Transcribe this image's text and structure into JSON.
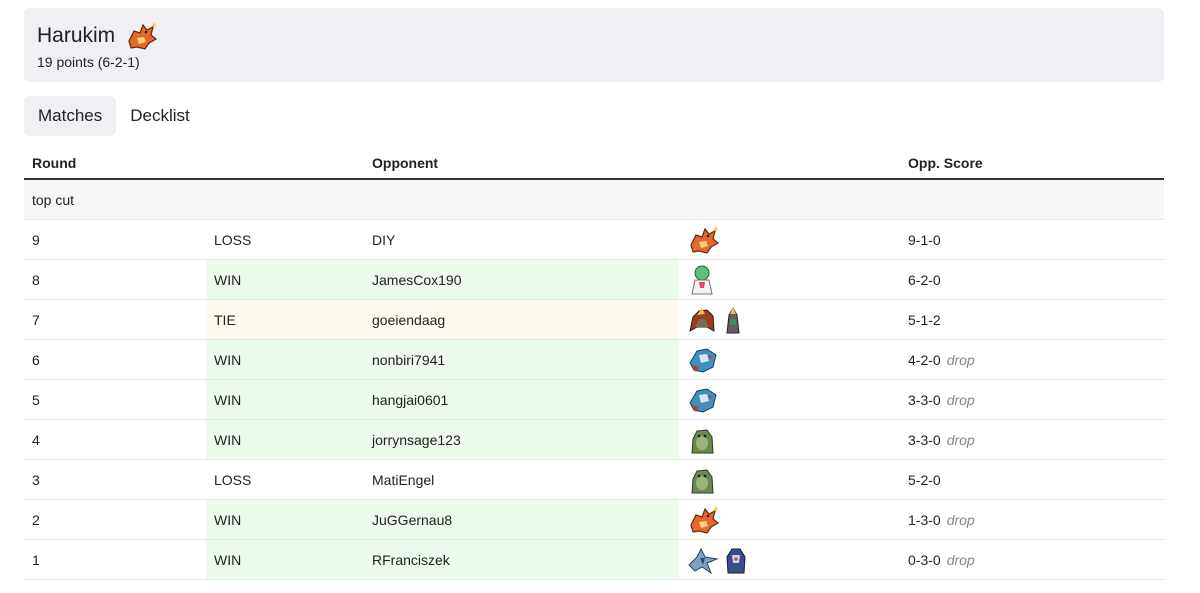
{
  "player": {
    "name": "Harukim",
    "points": "19 points (6-2-1)",
    "deck_icon": "charizard-icon"
  },
  "tabs": [
    {
      "label": "Matches",
      "active": true
    },
    {
      "label": "Decklist",
      "active": false
    }
  ],
  "table": {
    "headers": {
      "round": "Round",
      "result": "",
      "opponent": "Opponent",
      "deck": "",
      "score": "Opp. Score"
    },
    "section_label": "top cut",
    "rows": [
      {
        "round": "9",
        "result": "LOSS",
        "opponent": "DIY",
        "icons": [
          "charizard-icon"
        ],
        "score": "9-1-0",
        "drop": ""
      },
      {
        "round": "8",
        "result": "WIN",
        "opponent": "JamesCox190",
        "icons": [
          "gardevoir-icon"
        ],
        "score": "6-2-0",
        "drop": ""
      },
      {
        "round": "7",
        "result": "TIE",
        "opponent": "goeiendaag",
        "icons": [
          "entei-icon",
          "kingambit-icon"
        ],
        "score": "5-1-2",
        "drop": ""
      },
      {
        "round": "6",
        "result": "WIN",
        "opponent": "nonbiri7941",
        "icons": [
          "dragapult-icon"
        ],
        "score": "4-2-0",
        "drop": "drop"
      },
      {
        "round": "5",
        "result": "WIN",
        "opponent": "hangjai0601",
        "icons": [
          "dragapult-icon"
        ],
        "score": "3-3-0",
        "drop": "drop"
      },
      {
        "round": "4",
        "result": "WIN",
        "opponent": "jorrynsage123",
        "icons": [
          "slowking-icon"
        ],
        "score": "3-3-0",
        "drop": "drop"
      },
      {
        "round": "3",
        "result": "LOSS",
        "opponent": "MatiEngel",
        "icons": [
          "slowking-icon"
        ],
        "score": "5-2-0",
        "drop": ""
      },
      {
        "round": "2",
        "result": "WIN",
        "opponent": "JuGGernau8",
        "icons": [
          "charizard-icon"
        ],
        "score": "1-3-0",
        "drop": "drop"
      },
      {
        "round": "1",
        "result": "WIN",
        "opponent": "RFranciszek",
        "icons": [
          "lugia-icon",
          "archaludon-icon"
        ],
        "score": "0-3-0",
        "drop": "drop"
      }
    ]
  },
  "colors": {
    "win_bg": "#ecfbec",
    "tie_bg": "#fffaf0",
    "header_bg": "#efeff4"
  }
}
